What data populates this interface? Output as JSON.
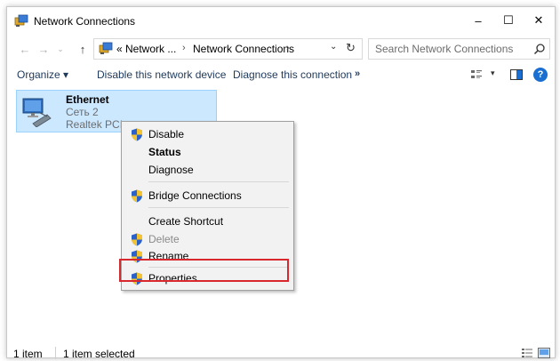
{
  "window": {
    "title": "Network Connections",
    "controls": {
      "minimize": "–",
      "maximize": "☐",
      "close": "✕"
    }
  },
  "address_bar": {
    "nav": {
      "back": "←",
      "forward": "→",
      "recent": "⌄",
      "up": "↑"
    },
    "breadcrumb": [
      {
        "label": "« Network ..."
      },
      {
        "label": "Network Connections"
      }
    ],
    "separator": "›",
    "dropdown": "⌄",
    "refresh": "↻"
  },
  "search": {
    "placeholder": "Search Network Connections",
    "value": ""
  },
  "command_bar": {
    "organize": "Organize ▾",
    "disable": "Disable this network device",
    "diagnose": "Diagnose this connection",
    "more": "»",
    "view_dropdown": "▾",
    "help": "?"
  },
  "items": [
    {
      "name": "Ethernet",
      "network": "Сеть 2",
      "device": "Realtek PCIe",
      "selected": true
    }
  ],
  "context_menu": {
    "items": [
      {
        "label": "Disable",
        "shield": true,
        "bold": false,
        "disabled": false
      },
      {
        "label": "Status",
        "shield": false,
        "bold": true,
        "disabled": false
      },
      {
        "label": "Diagnose",
        "shield": false,
        "bold": false,
        "disabled": false
      },
      {
        "label": "Bridge Connections",
        "shield": true,
        "bold": false,
        "disabled": false
      },
      {
        "label": "Create Shortcut",
        "shield": false,
        "bold": false,
        "disabled": false
      },
      {
        "label": "Delete",
        "shield": true,
        "bold": false,
        "disabled": true
      },
      {
        "label": "Rename",
        "shield": true,
        "bold": false,
        "disabled": false
      },
      {
        "label": "Properties",
        "shield": true,
        "bold": false,
        "disabled": false,
        "highlighted": true
      }
    ]
  },
  "status_bar": {
    "count": "1 item",
    "selected": "1 item selected"
  },
  "colors": {
    "selection_bg": "#cce8ff",
    "selection_border": "#99d1ff",
    "highlight": "#d9272e",
    "link": "#1e395b",
    "help": "#1a6fd1"
  },
  "icons": {
    "title": "network-connections-icon",
    "search": "search-icon",
    "item": "ethernet-adapter-icon",
    "shield": "uac-shield-icon"
  }
}
